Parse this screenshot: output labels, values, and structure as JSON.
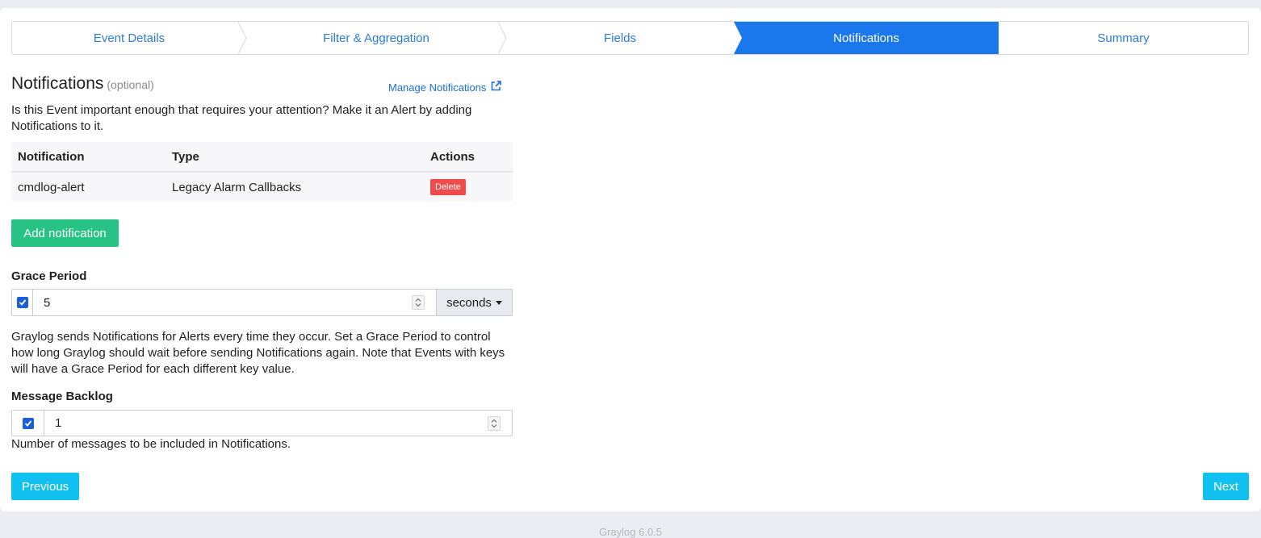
{
  "wizard": {
    "steps": [
      {
        "label": "Event Details"
      },
      {
        "label": "Filter & Aggregation"
      },
      {
        "label": "Fields"
      },
      {
        "label": "Notifications"
      },
      {
        "label": "Summary"
      }
    ],
    "active_step": "Notifications"
  },
  "notifications": {
    "title": "Notifications",
    "optional_label": "(optional)",
    "manage_link": "Manage Notifications",
    "description": "Is this Event important enough that requires your attention? Make it an Alert by adding Notifications to it.",
    "table": {
      "headers": [
        "Notification",
        "Type",
        "Actions"
      ],
      "rows": [
        {
          "notification": "cmdlog-alert",
          "type": "Legacy Alarm Callbacks",
          "action_label": "Delete"
        }
      ]
    },
    "add_button": "Add notification"
  },
  "grace_period": {
    "label": "Grace Period",
    "checked": true,
    "value": "5",
    "unit": "seconds",
    "description": "Graylog sends Notifications for Alerts every time they occur. Set a Grace Period to control how long Graylog should wait before sending Notifications again. Note that Events with keys will have a Grace Period for each different key value."
  },
  "message_backlog": {
    "label": "Message Backlog",
    "checked": true,
    "value": "1",
    "description": "Number of messages to be included in Notifications."
  },
  "nav": {
    "previous": "Previous",
    "next": "Next"
  },
  "footer": "Graylog 6.0.5",
  "colors": {
    "active_step": "#1b77ec",
    "link": "#1b6fd6",
    "delete": "#f04a4a",
    "add": "#26c384",
    "nav_button": "#10c1f0"
  }
}
